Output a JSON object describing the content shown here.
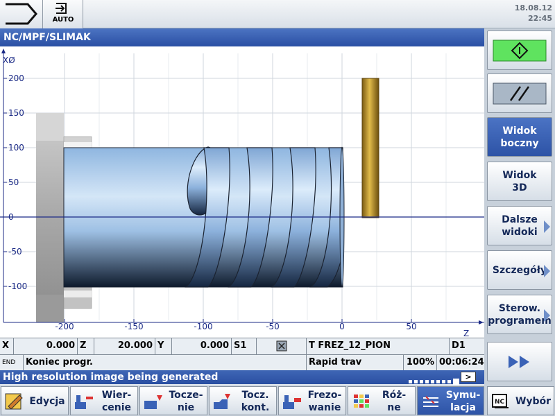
{
  "header": {
    "mode_label": "AUTO",
    "date": "18.08.12",
    "time": "22:45"
  },
  "title": "NC/MPF/SLIMAK",
  "simulation": {
    "x_axis_ticks": [
      "-200",
      "-150",
      "-100",
      "-50",
      "0",
      "50"
    ],
    "y_axis_ticks": [
      "200",
      "150",
      "100",
      "50",
      "0",
      "-50",
      "-100"
    ],
    "x_axis_label": "Z",
    "y_axis_label": "XØ"
  },
  "status": {
    "x_label": "X",
    "x_value": "0.000",
    "z_label": "Z",
    "z_value": "20.000",
    "y_label": "Y",
    "y_value": "0.000",
    "s_label": "S1",
    "tool": "T FREZ_12_PION",
    "d_number": "D1",
    "end_label": "END",
    "program_state": "Koniec progr.",
    "feed_mode": "Rapid trav",
    "override": "100%",
    "run_time": "00:06:24"
  },
  "message": "High resolution image being generated",
  "right_softkeys": [
    {
      "label": "",
      "icon": "cycle-start-icon"
    },
    {
      "label": "",
      "icon": "parallel-lines-icon"
    },
    {
      "label": "Widok\nboczny"
    },
    {
      "label": "Widok\n3D"
    },
    {
      "label": "Dalsze\nwidoki"
    },
    {
      "label": "Szczegóły"
    },
    {
      "label": "Sterow.\nprogramem"
    },
    {
      "label": "",
      "icon": "double-arrow-right-icon"
    }
  ],
  "bottom_softkeys": [
    {
      "label": "Edycja"
    },
    {
      "label": "Wier-\ncenie"
    },
    {
      "label": "Tocze-\nnie"
    },
    {
      "label": "Tocz.\nkont."
    },
    {
      "label": "Frezo-\nwanie"
    },
    {
      "label": "Róż-\nne"
    },
    {
      "label": "Symu-\nlacja"
    },
    {
      "label": "Wybór"
    }
  ],
  "colors": {
    "title_bar": "#2f55a8",
    "active_softkey": "#3a62b6",
    "cycle_start_green": "#5fe35f",
    "tool_gold": "#c59a2e"
  }
}
